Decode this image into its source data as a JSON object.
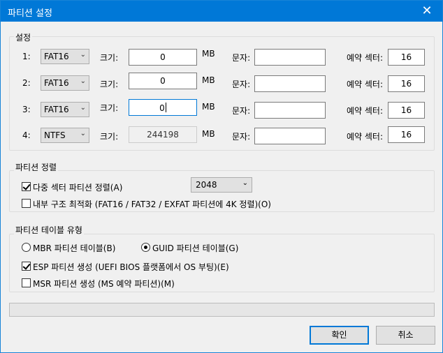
{
  "window": {
    "title": "파티션 설정",
    "close_glyph": "✕"
  },
  "settings": {
    "group_label": "설정",
    "size_label": "크기:",
    "unit": "MB",
    "letter_label": "문자:",
    "reserved_label": "예약 섹터:",
    "chev": "⌄",
    "rows": [
      {
        "num": "1:",
        "fs": "FAT16",
        "size": "0",
        "letter": "",
        "reserved": "16"
      },
      {
        "num": "2:",
        "fs": "FAT16",
        "size": "0",
        "letter": "",
        "reserved": "16"
      },
      {
        "num": "3:",
        "fs": "FAT16",
        "size": "0",
        "letter": "",
        "reserved": "16"
      },
      {
        "num": "4:",
        "fs": "NTFS",
        "size": "244198",
        "letter": "",
        "reserved": "16"
      }
    ]
  },
  "alignment": {
    "group_label": "파티션 정렬",
    "multi_sector_label": "다중 섹터 파티션 정렬(A)",
    "multi_sector_checked": true,
    "multi_sector_value": "2048",
    "internal_opt_label": "내부 구조 최적화 (FAT16 / FAT32 / EXFAT 파티션에 4K 정렬)(O)",
    "internal_opt_checked": false
  },
  "table_type": {
    "group_label": "파티션 테이블 유형",
    "mbr_label": "MBR 파티션 테이블(B)",
    "gpt_label": "GUID 파티션 테이블(G)",
    "selected": "GUID",
    "esp_label": "ESP 파티션 생성 (UEFI BIOS 플랫폼에서 OS 부팅)(E)",
    "esp_checked": true,
    "msr_label": "MSR 파티션 생성 (MS 예약 파티션)(M)",
    "msr_checked": false
  },
  "buttons": {
    "ok": "확인",
    "cancel": "취소"
  }
}
